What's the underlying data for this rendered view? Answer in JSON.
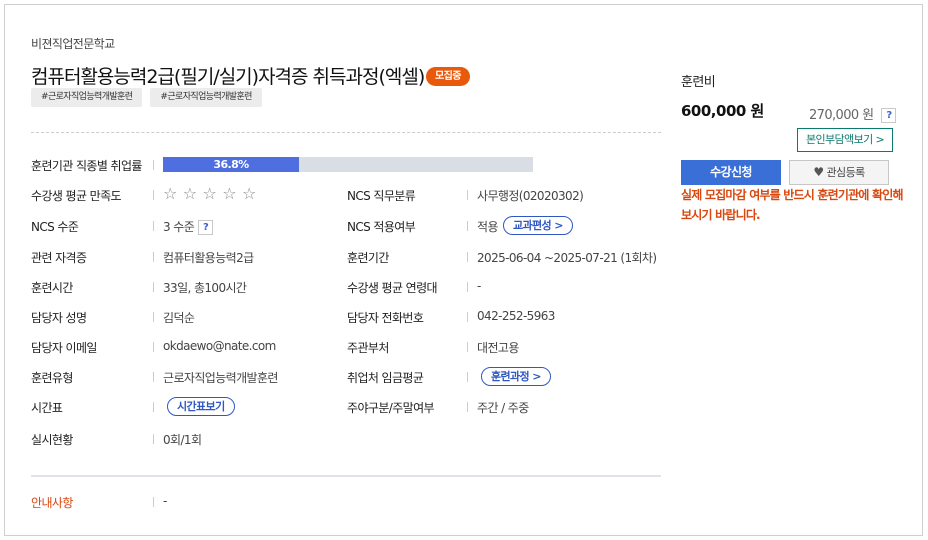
{
  "header": {
    "school": "비젼직업전문학교",
    "title": "컴퓨터활용능력2급(필기/실기)자격증 취득과정(엑셀)",
    "status_badge": "모집중",
    "tags": [
      "#근로자직업능력개발훈련",
      "#근로자직업능력개발훈련"
    ]
  },
  "details": {
    "employment_rate": {
      "label": "훈련기관 직종별 취업률",
      "value_text": "36.8%",
      "value": 36.8
    },
    "satisfaction": {
      "label": "수강생 평균 만족도",
      "stars_total": 5,
      "stars_filled": 0
    },
    "ncs_level": {
      "label": "NCS 수준",
      "value": "3 수준",
      "help": "?"
    },
    "related_cert": {
      "label": "관련 자격증",
      "value": "컴퓨터활용능력2급"
    },
    "training_time": {
      "label": "훈련시간",
      "value": "33일, 총100시간"
    },
    "manager_name": {
      "label": "담당자 성명",
      "value": "김덕순"
    },
    "manager_email": {
      "label": "담당자 이메일",
      "value": "okdaewo@nate.com"
    },
    "training_type": {
      "label": "훈련유형",
      "value": "근로자직업능력개발훈련"
    },
    "timetable": {
      "label": "시간표",
      "button": "시간표보기"
    },
    "actual_status": {
      "label": "실시현황",
      "value": "0회/1회"
    },
    "ncs_category": {
      "label": "NCS 직무분류",
      "value": "사무행정(02020302)"
    },
    "ncs_applied": {
      "label": "NCS 적용여부",
      "value": "적용",
      "button": "교과편성 >"
    },
    "training_period": {
      "label": "훈련기간",
      "value": "2025-06-04 ~2025-07-21 (1회차)"
    },
    "avg_age": {
      "label": "수강생 평균 연령대",
      "value": "-"
    },
    "manager_phone": {
      "label": "담당자 전화번호",
      "value": "042-252-5963"
    },
    "department": {
      "label": "주관부처",
      "value": "대전고용"
    },
    "avg_wage": {
      "label": "취업처 임금평균",
      "button": "훈련과정 >"
    },
    "day_night": {
      "label": "주야구분/주말여부",
      "value": "주간 / 주중"
    }
  },
  "notice": {
    "label": "안내사항",
    "value": "-"
  },
  "sidebar": {
    "fee_label": "훈련비",
    "fee": "600,000 원",
    "self_pay": "270,000 원",
    "help": "?",
    "self_pay_button": "본인부담액보기 >",
    "apply_button": "수강신청",
    "favorite_button": "관심등록",
    "warning": "실제 모집마감 여부를 반드시 훈련기관에 확인해보시기 바랍니다."
  },
  "colors": {
    "accent": "#3a6fd8",
    "bar_fill": "#4f6fe0",
    "badge": "#e8590c",
    "warning": "#d9480f",
    "self_pay_border": "#0b7a6e"
  }
}
